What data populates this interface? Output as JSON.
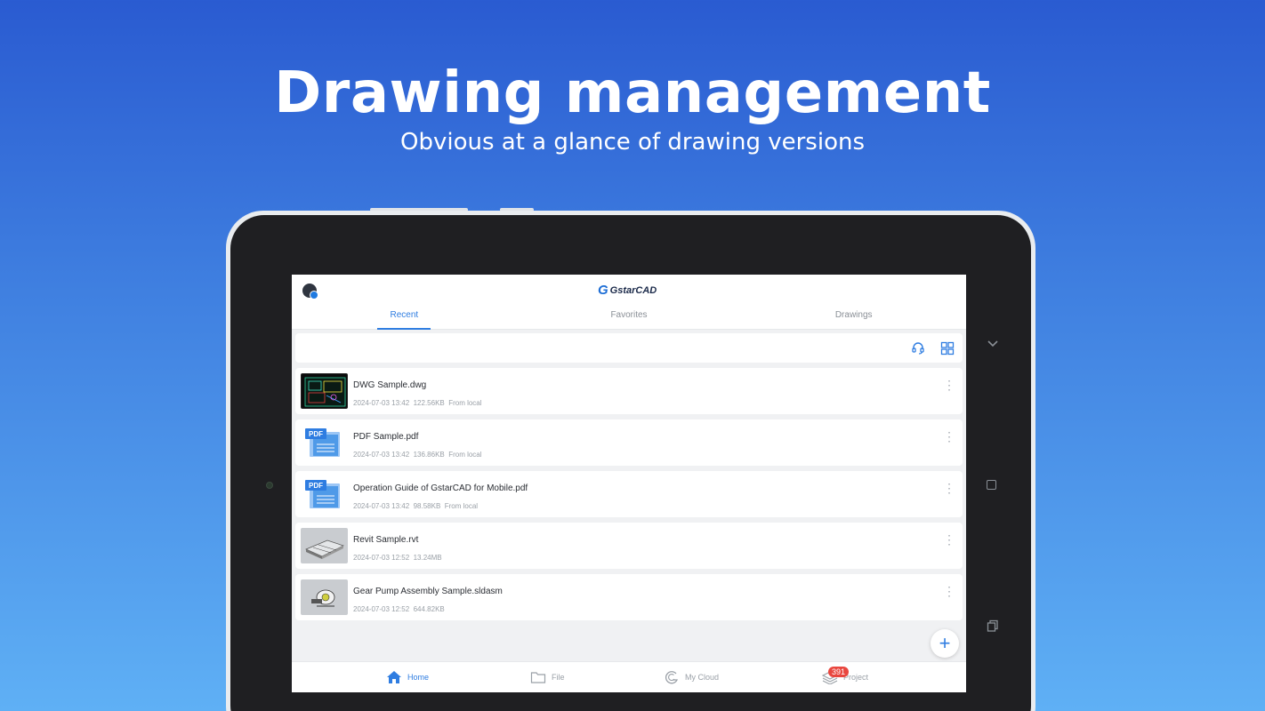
{
  "hero": {
    "title": "Drawing management",
    "subtitle": "Obvious at a glance of drawing versions"
  },
  "app": {
    "logo_mark": "G",
    "logo_text": "GstarCAD"
  },
  "tabs": [
    {
      "label": "Recent",
      "active": true
    },
    {
      "label": "Favorites",
      "active": false
    },
    {
      "label": "Drawings",
      "active": false
    }
  ],
  "toolbar": {
    "support_icon": "headset-icon",
    "view_icon": "grid-view-icon"
  },
  "files": [
    {
      "name": "DWG Sample.dwg",
      "meta": "2024-07-03 13:42  122.56KB  From local",
      "thumb": "dwg"
    },
    {
      "name": "PDF Sample.pdf",
      "meta": "2024-07-03 13:42  136.86KB  From local",
      "thumb": "pdf"
    },
    {
      "name": "Operation Guide of GstarCAD for Mobile.pdf",
      "meta": "2024-07-03 13:42  98.58KB  From local",
      "thumb": "pdf"
    },
    {
      "name": "Revit Sample.rvt",
      "meta": "2024-07-03 12:52  13.24MB",
      "thumb": "rvt"
    },
    {
      "name": "Gear Pump Assembly Sample.sldasm",
      "meta": "2024-07-03 12:52  644.82KB",
      "thumb": "sldasm"
    }
  ],
  "pdf_label": "PDF",
  "fab_label": "+",
  "bottom_nav": [
    {
      "label": "Home",
      "icon": "home-icon",
      "active": true
    },
    {
      "label": "File",
      "icon": "folder-icon",
      "active": false
    },
    {
      "label": "My Cloud",
      "icon": "cloud-icon",
      "active": false
    },
    {
      "label": "Project",
      "icon": "layers-icon",
      "active": false,
      "badge": "391"
    }
  ],
  "colors": {
    "accent": "#2f7de1",
    "badge": "#e9473f",
    "bg_top": "#2a5bd1",
    "bg_bottom": "#5fb0f5"
  }
}
